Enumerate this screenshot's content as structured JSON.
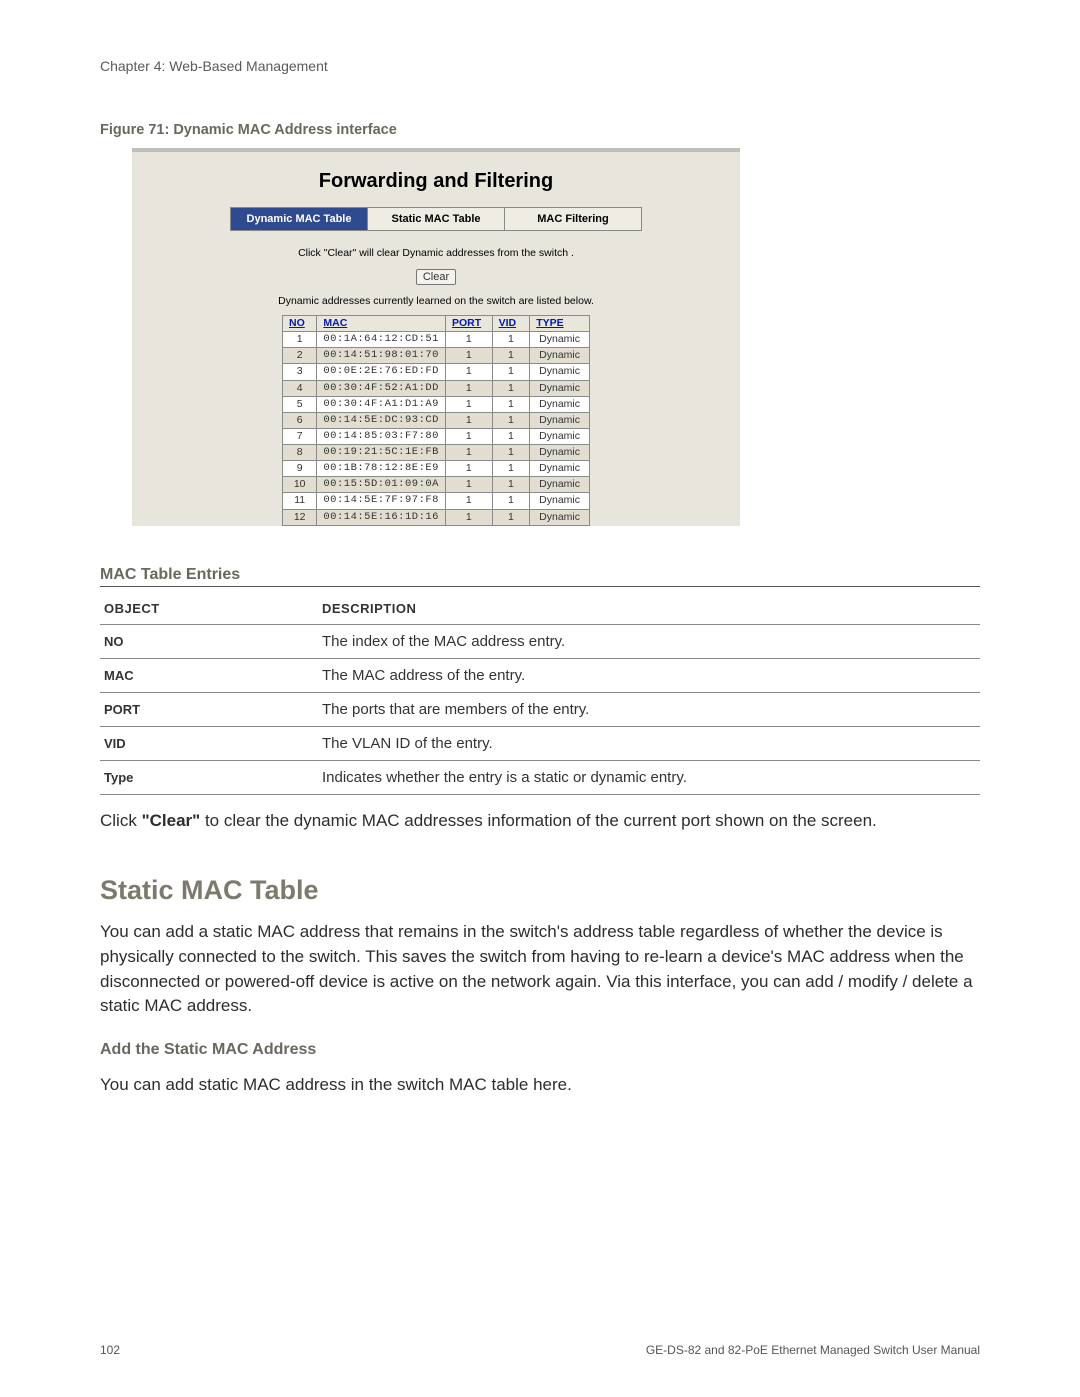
{
  "chapter": "Chapter 4: Web-Based Management",
  "figure_caption": "Figure 71: Dynamic MAC Address interface",
  "screenshot": {
    "title": "Forwarding and Filtering",
    "tabs": [
      "Dynamic MAC Table",
      "Static MAC Table",
      "MAC Filtering"
    ],
    "active_tab_index": 0,
    "note1": "Click \"Clear\" will clear Dynamic addresses from the switch .",
    "clear_btn": "Clear",
    "note2": "Dynamic addresses currently learned on the switch are listed below.",
    "columns": [
      "NO",
      "MAC",
      "PORT",
      "VID",
      "TYPE"
    ],
    "rows": [
      {
        "no": "1",
        "mac": "00:1A:64:12:CD:51",
        "port": "1",
        "vid": "1",
        "type": "Dynamic"
      },
      {
        "no": "2",
        "mac": "00:14:51:98:01:70",
        "port": "1",
        "vid": "1",
        "type": "Dynamic"
      },
      {
        "no": "3",
        "mac": "00:0E:2E:76:ED:FD",
        "port": "1",
        "vid": "1",
        "type": "Dynamic"
      },
      {
        "no": "4",
        "mac": "00:30:4F:52:A1:DD",
        "port": "1",
        "vid": "1",
        "type": "Dynamic"
      },
      {
        "no": "5",
        "mac": "00:30:4F:A1:D1:A9",
        "port": "1",
        "vid": "1",
        "type": "Dynamic"
      },
      {
        "no": "6",
        "mac": "00:14:5E:DC:93:CD",
        "port": "1",
        "vid": "1",
        "type": "Dynamic"
      },
      {
        "no": "7",
        "mac": "00:14:85:03:F7:80",
        "port": "1",
        "vid": "1",
        "type": "Dynamic"
      },
      {
        "no": "8",
        "mac": "00:19:21:5C:1E:FB",
        "port": "1",
        "vid": "1",
        "type": "Dynamic"
      },
      {
        "no": "9",
        "mac": "00:1B:78:12:8E:E9",
        "port": "1",
        "vid": "1",
        "type": "Dynamic"
      },
      {
        "no": "10",
        "mac": "00:15:5D:01:09:0A",
        "port": "1",
        "vid": "1",
        "type": "Dynamic"
      },
      {
        "no": "11",
        "mac": "00:14:5E:7F:97:F8",
        "port": "1",
        "vid": "1",
        "type": "Dynamic"
      },
      {
        "no": "12",
        "mac": "00:14:5E:16:1D:16",
        "port": "1",
        "vid": "1",
        "type": "Dynamic"
      }
    ]
  },
  "entries_heading": "MAC Table Entries",
  "entries_columns": [
    "OBJECT",
    "DESCRIPTION"
  ],
  "entries_rows": [
    {
      "obj": "NO",
      "desc": "The index of the MAC address entry."
    },
    {
      "obj": "MAC",
      "desc": "The MAC address of the entry."
    },
    {
      "obj": "PORT",
      "desc": "The ports that are members of the entry."
    },
    {
      "obj": "VID",
      "desc": "The VLAN ID of the entry."
    },
    {
      "obj": "Type",
      "desc": "Indicates whether the entry is a static or dynamic entry."
    }
  ],
  "clear_para_pre": "Click ",
  "clear_para_bold": "\"Clear\"",
  "clear_para_post": " to clear the dynamic MAC addresses information of the current port shown on the screen.",
  "section2_heading": "Static MAC Table",
  "section2_para": "You can add a static MAC address that remains in the switch's address table regardless of whether the device is physically connected to the switch. This saves the switch from having to re-learn a device's MAC address when the disconnected or powered-off device is active on the network again. Via this interface, you can add / modify / delete a static MAC address.",
  "subhead": "Add the Static MAC Address",
  "subpara": "You can add static MAC address in the switch MAC table here.",
  "footer_left": "102",
  "footer_right": "GE-DS-82 and 82-PoE Ethernet Managed Switch User Manual"
}
